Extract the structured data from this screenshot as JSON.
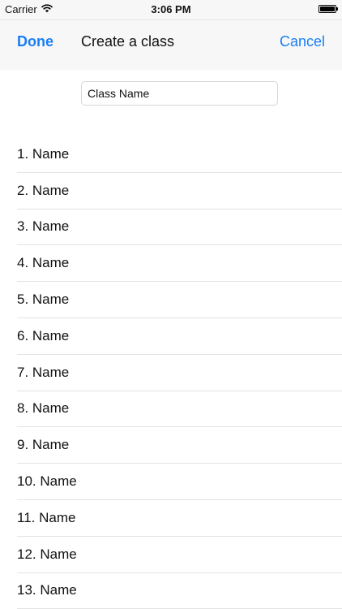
{
  "status_bar": {
    "carrier": "Carrier",
    "time": "3:06 PM",
    "icons": [
      "wifi-icon",
      "battery-icon"
    ]
  },
  "nav": {
    "done_label": "Done",
    "title": "Create a class",
    "cancel_label": "Cancel"
  },
  "class_name_field": {
    "placeholder": "Class Name",
    "value": ""
  },
  "names": [
    {
      "label": "1. Name"
    },
    {
      "label": "2. Name"
    },
    {
      "label": "3. Name"
    },
    {
      "label": "4. Name"
    },
    {
      "label": "5. Name"
    },
    {
      "label": "6. Name"
    },
    {
      "label": "7. Name"
    },
    {
      "label": "8. Name"
    },
    {
      "label": "9. Name"
    },
    {
      "label": "10. Name"
    },
    {
      "label": "11. Name"
    },
    {
      "label": "12. Name"
    },
    {
      "label": "13. Name"
    }
  ],
  "colors": {
    "accent": "#1a7ef5",
    "bar_background": "#f7f7f7",
    "separator": "#e3e3e3"
  }
}
